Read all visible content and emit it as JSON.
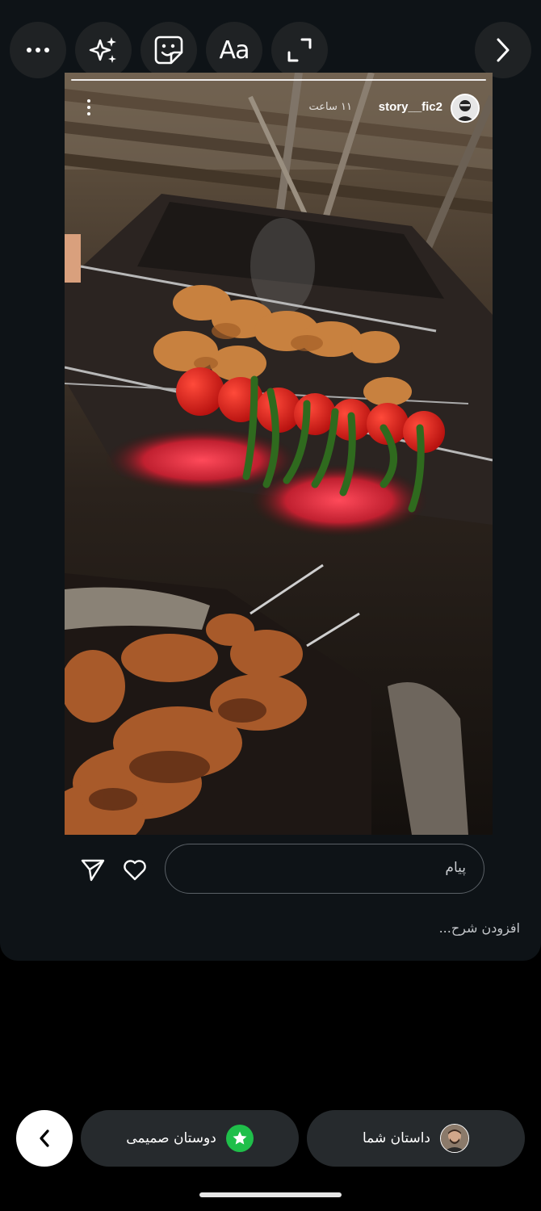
{
  "toolbar": {
    "items": [
      {
        "name": "more",
        "icon": "more-horizontal-icon"
      },
      {
        "name": "effects",
        "icon": "sparkles-icon"
      },
      {
        "name": "sticker",
        "icon": "sticker-icon"
      },
      {
        "name": "text",
        "icon": "text-icon",
        "label": "Aa"
      },
      {
        "name": "resize",
        "icon": "resize-icon"
      }
    ],
    "next_icon": "chevron-right-icon"
  },
  "story": {
    "username": "story__fic2",
    "time": "۱۱ ساعت",
    "menu_icon": "kebab-icon",
    "image_description_icon": "grill-photo"
  },
  "reply": {
    "placeholder": "پیام",
    "send_icon": "send-icon",
    "like_icon": "heart-icon"
  },
  "caption_placeholder": "افزودن شرح...",
  "bottom": {
    "close_friends_label": "دوستان صمیمی",
    "your_story_label": "داستان شما",
    "back_icon": "chevron-left-icon",
    "star_color": "#1fbf4a"
  }
}
